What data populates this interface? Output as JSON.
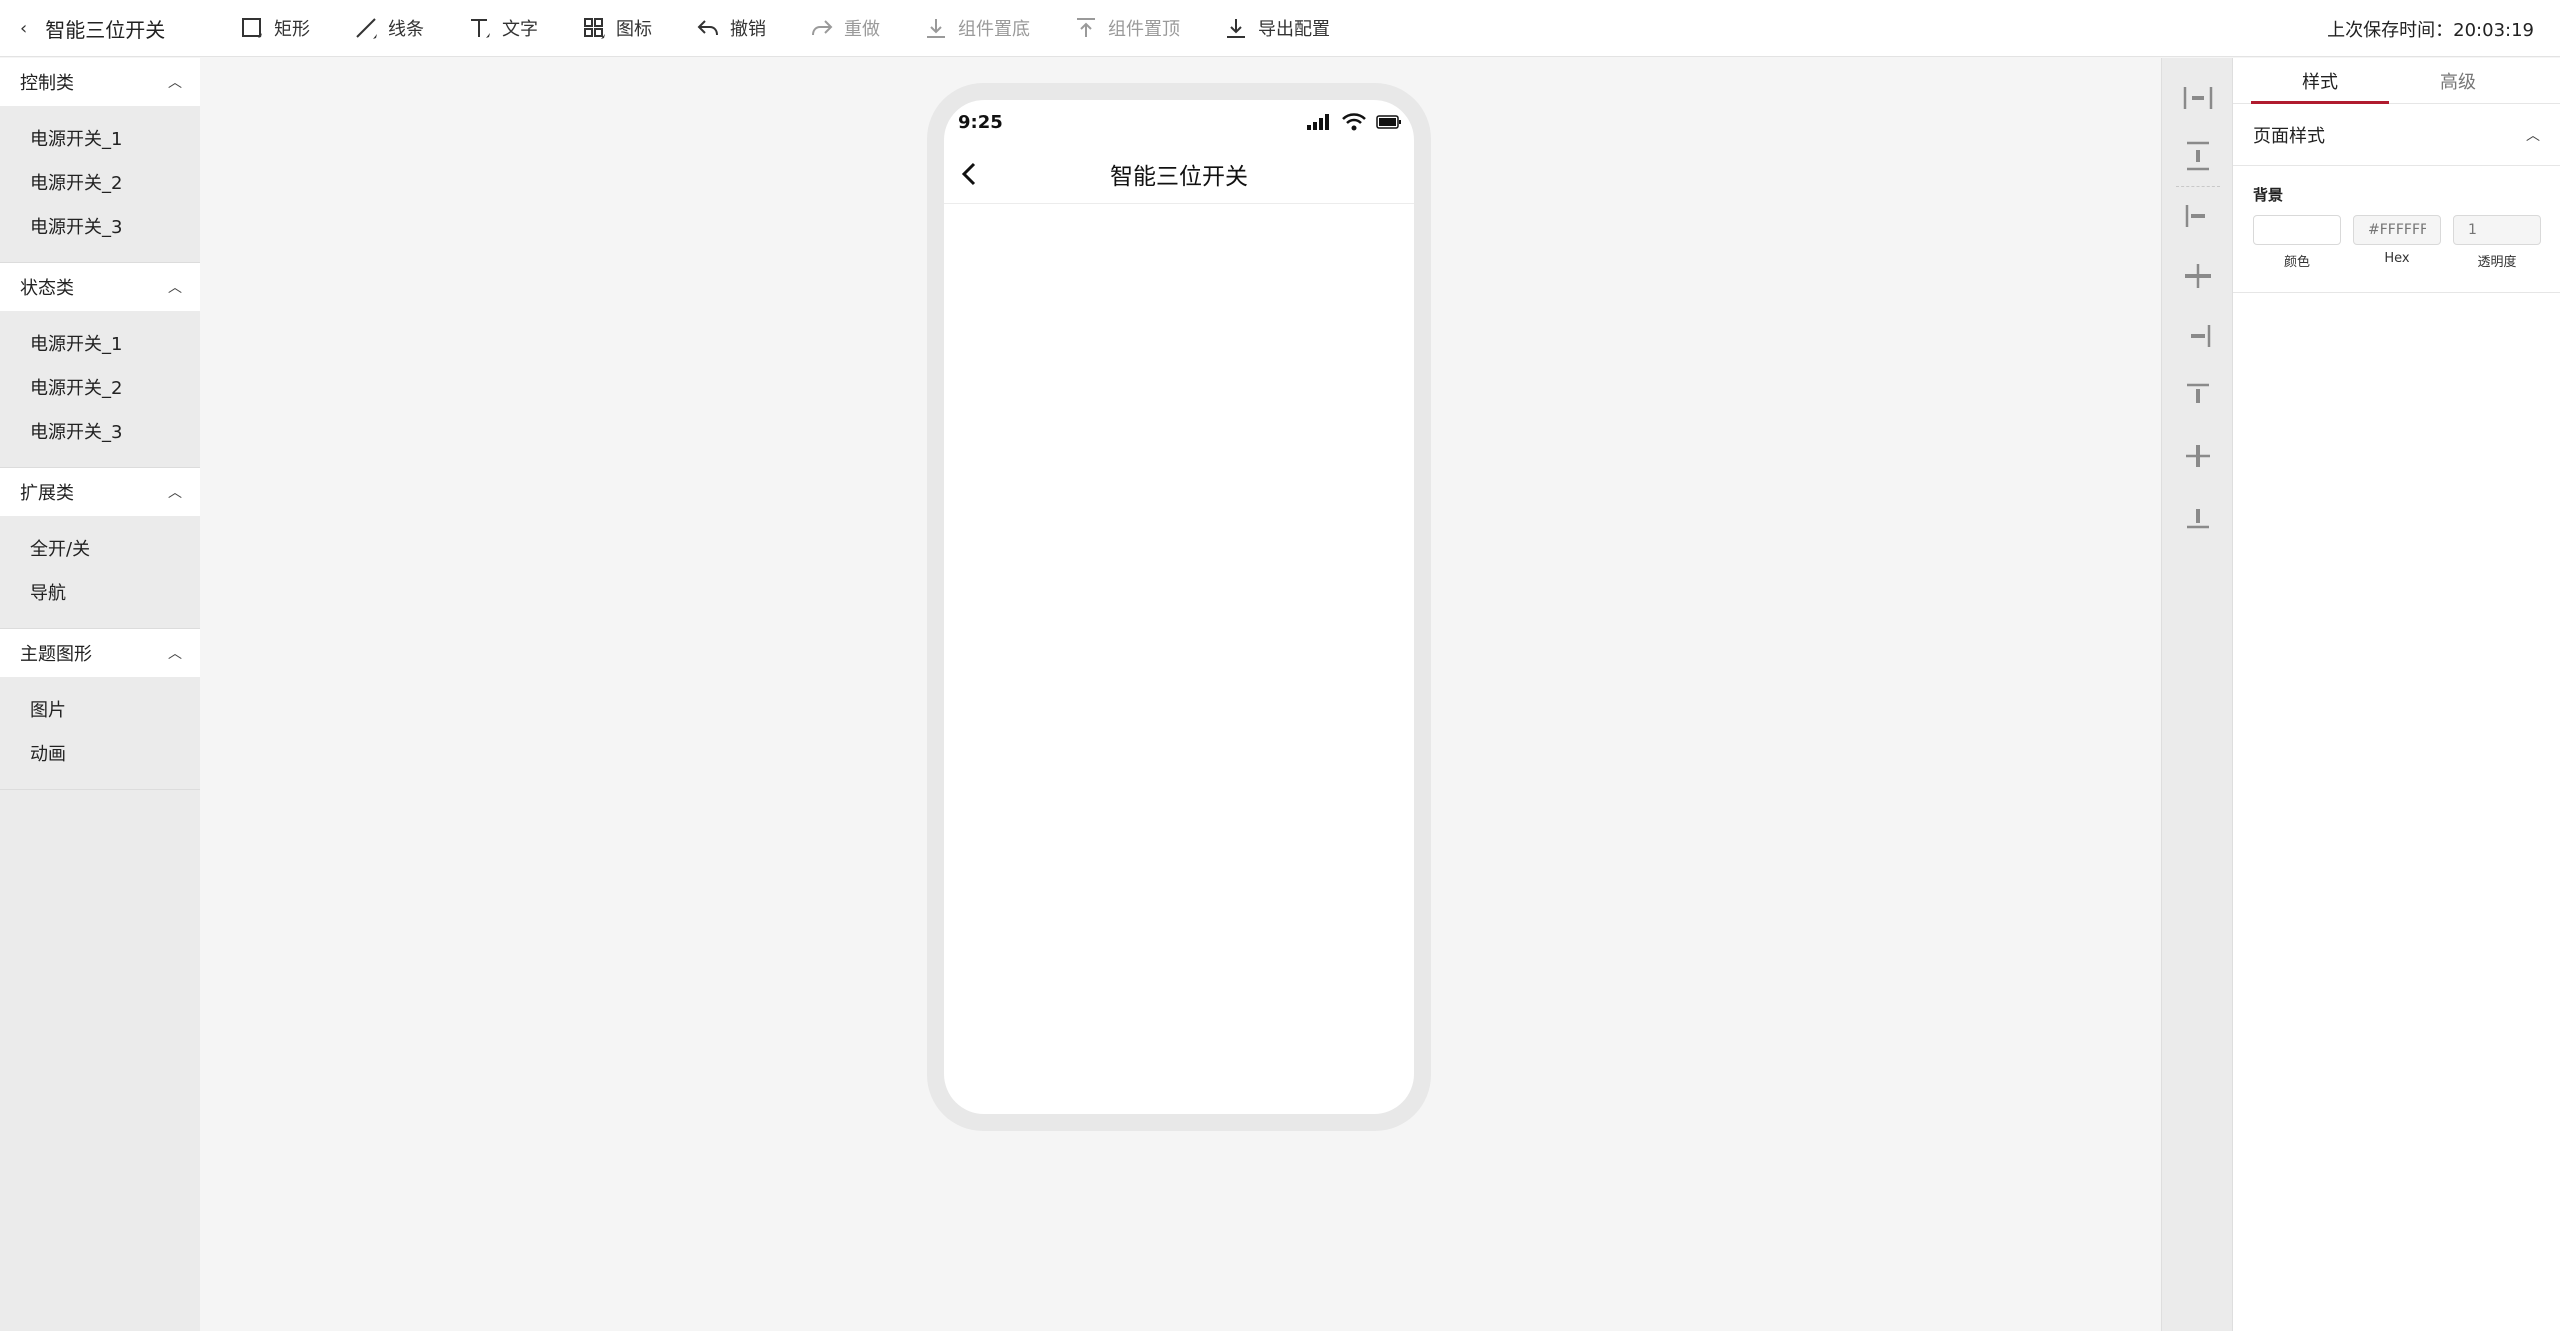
{
  "header": {
    "back_label": "智能三位开关",
    "save_time": "上次保存时间：20:03:19"
  },
  "toolbar": {
    "rect": "矩形",
    "line": "线条",
    "text": "文字",
    "icon": "图标",
    "undo": "撤销",
    "redo": "重做",
    "send_bottom": "组件置底",
    "bring_top": "组件置顶",
    "export": "导出配置"
  },
  "sidebar": {
    "groups": [
      {
        "title": "控制类",
        "items": [
          "电源开关_1",
          "电源开关_2",
          "电源开关_3"
        ]
      },
      {
        "title": "状态类",
        "items": [
          "电源开关_1",
          "电源开关_2",
          "电源开关_3"
        ]
      },
      {
        "title": "扩展类",
        "items": [
          "全开/关",
          "导航"
        ]
      },
      {
        "title": "主题图形",
        "items": [
          "图片",
          "动画"
        ]
      }
    ]
  },
  "phone": {
    "time": "9:25",
    "title": "智能三位开关"
  },
  "panel": {
    "tabs": [
      "样式",
      "高级"
    ],
    "section_title": "页面样式",
    "bg_label": "背景",
    "color_caption": "颜色",
    "hex_caption": "Hex",
    "opacity_caption": "透明度",
    "color_value": "",
    "hex_placeholder": "#FFFFFF",
    "opacity_placeholder": "1"
  },
  "colors": {
    "accent": "#b01b2e"
  }
}
